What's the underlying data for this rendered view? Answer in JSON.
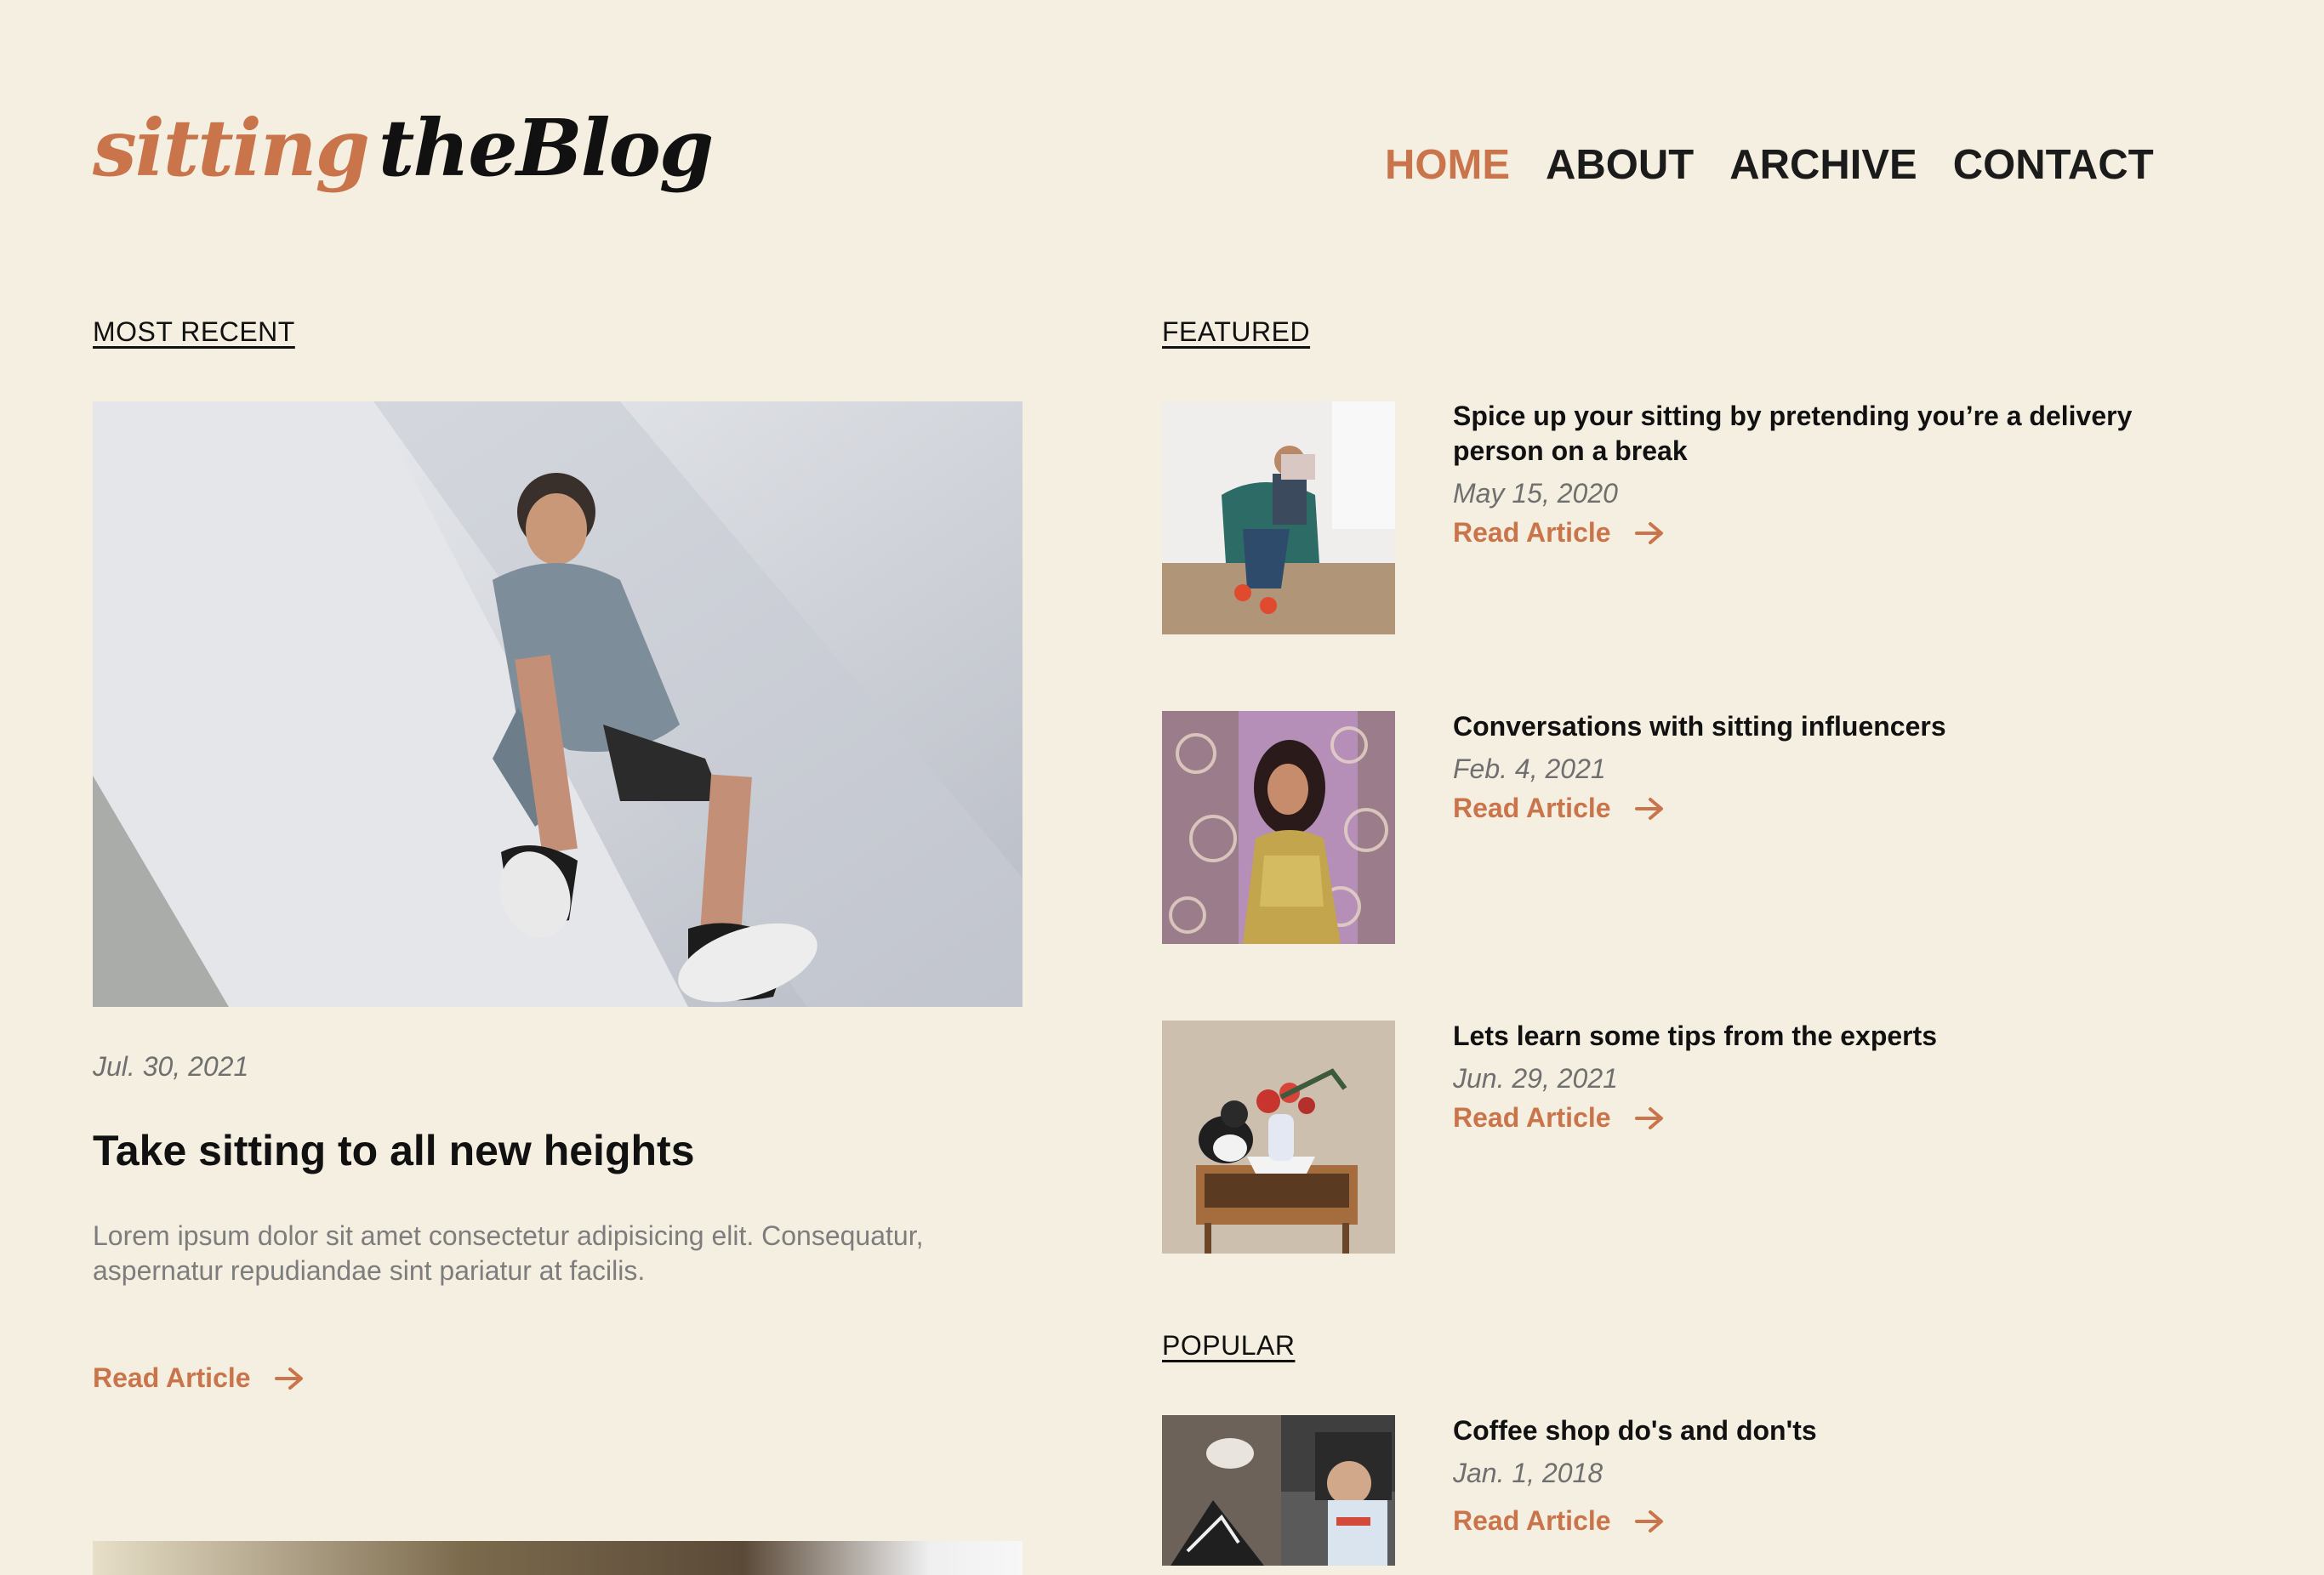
{
  "brand": {
    "logo_accent": "sitting",
    "logo_main": "theBlog",
    "accent_color": "#c9744a",
    "background_color": "#f5efe1"
  },
  "nav": {
    "items": [
      {
        "label": "HOME",
        "active": true
      },
      {
        "label": "ABOUT",
        "active": false
      },
      {
        "label": "ARCHIVE",
        "active": false
      },
      {
        "label": "CONTACT",
        "active": false
      }
    ]
  },
  "recent": {
    "heading": "MOST RECENT",
    "date": "Jul. 30, 2021",
    "title": "Take sitting to all new heights",
    "excerpt": "Lorem ipsum dolor sit amet consectetur adipisicing elit. Consequatur, aspernatur repudiandae sint pariatur at facilis.",
    "read_label": "Read Article"
  },
  "featured": {
    "heading": "FEATURED",
    "articles": [
      {
        "title": "Spice up your sitting by pretending you’re a delivery person on a break",
        "date": "May 15, 2020",
        "read_label": "Read Article"
      },
      {
        "title": "Conversations with sitting influencers",
        "date": "Feb. 4, 2021",
        "read_label": "Read Article"
      },
      {
        "title": "Lets learn some tips from the experts",
        "date": "Jun. 29, 2021",
        "read_label": "Read Article"
      }
    ]
  },
  "popular": {
    "heading": "POPULAR",
    "articles": [
      {
        "title": "Coffee shop do's and don'ts",
        "date": "Jan. 1, 2018",
        "read_label": "Read Article"
      }
    ]
  }
}
